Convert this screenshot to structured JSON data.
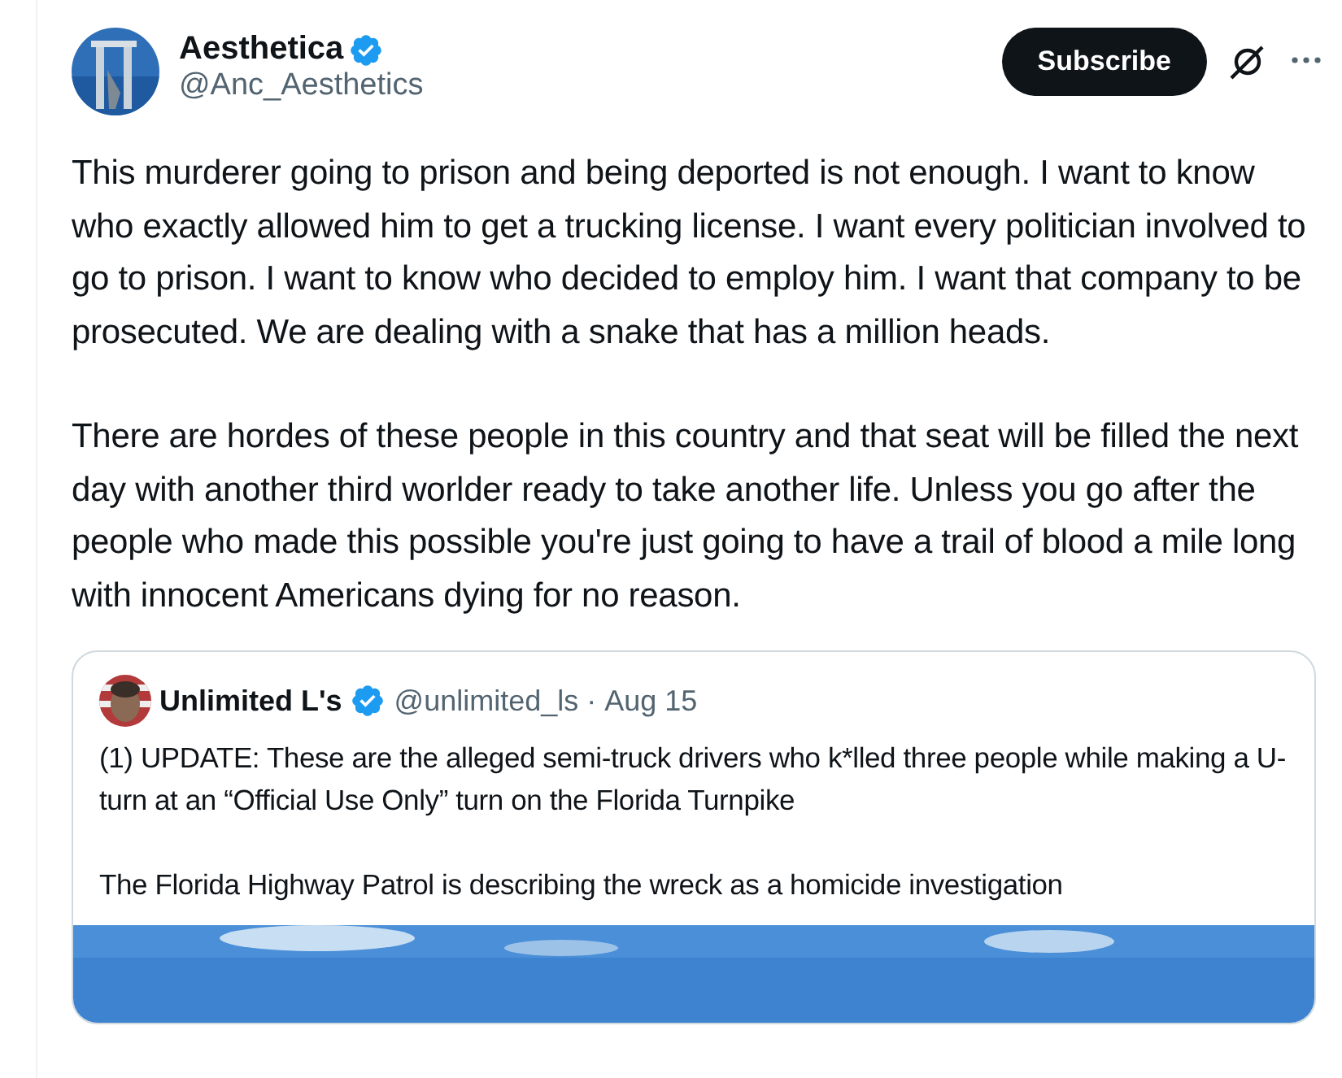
{
  "post": {
    "author": {
      "name": "Aesthetica",
      "handle": "@Anc_Aesthetics",
      "verified": true
    },
    "subscribe_button": "Subscribe",
    "paragraphs": [
      "This murderer going to prison and being deported is not enough. I want to know who exactly allowed him to get a trucking license.  I want every politician involved to go to prison. I want to know who decided to employ him. I want that company to be prosecuted. We are dealing with a snake that has a million heads.",
      "There are hordes of these people in this country and that seat will be filled the next day with another third worlder ready to take another life. Unless you go after the people who made this possible you're just going to have a trail of blood a mile long with innocent Americans dying for no reason."
    ],
    "quoted_post": {
      "author": {
        "name": "Unlimited L's",
        "handle": "@unlimited_ls",
        "verified": true
      },
      "separator": "·",
      "date": "Aug 15",
      "paragraphs": [
        "(1) UPDATE: These are the alleged semi-truck drivers who k*lled three people while making a U-turn at an “Official Use Only” turn on the Florida Turnpike",
        "The Florida Highway Patrol is describing the wreck as a homicide investigation"
      ]
    }
  }
}
